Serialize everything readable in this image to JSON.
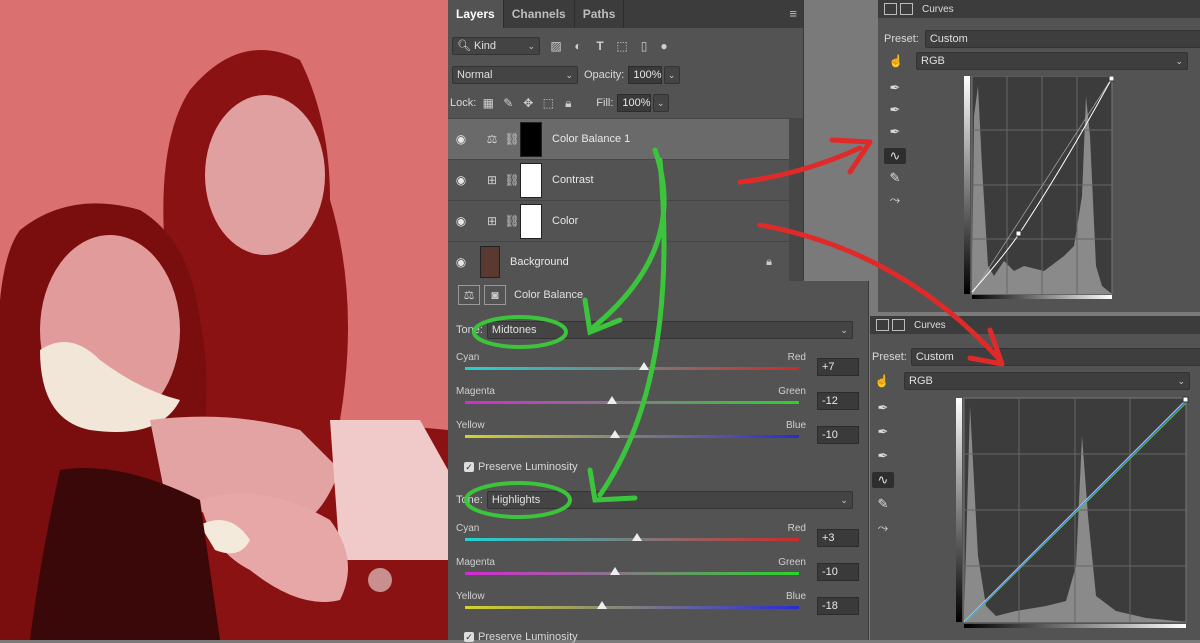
{
  "layers_panel": {
    "tabs": [
      "Layers",
      "Channels",
      "Paths"
    ],
    "filter_kind": "Kind",
    "blend_mode": "Normal",
    "opacity_label": "Opacity:",
    "opacity_value": "100%",
    "lock_label": "Lock:",
    "fill_label": "Fill:",
    "fill_value": "100%",
    "layers": [
      {
        "name": "Color Balance 1",
        "type": "color-balance"
      },
      {
        "name": "Contrast",
        "type": "curves"
      },
      {
        "name": "Color",
        "type": "curves"
      },
      {
        "name": "Background",
        "type": "image",
        "locked": true
      }
    ]
  },
  "color_balance": {
    "title": "Color Balance",
    "tone_label": "Tone:",
    "preserve_label": "Preserve Luminosity",
    "sections": [
      {
        "tone": "Midtones",
        "sliders": [
          {
            "left": "Cyan",
            "right": "Red",
            "value": "+7",
            "level": 7
          },
          {
            "left": "Magenta",
            "right": "Green",
            "value": "-12",
            "level": -12
          },
          {
            "left": "Yellow",
            "right": "Blue",
            "value": "-10",
            "level": -10
          }
        ]
      },
      {
        "tone": "Highlights",
        "sliders": [
          {
            "left": "Cyan",
            "right": "Red",
            "value": "+3",
            "level": 3
          },
          {
            "left": "Magenta",
            "right": "Green",
            "value": "-10",
            "level": -10
          },
          {
            "left": "Yellow",
            "right": "Blue",
            "value": "-18",
            "level": -18
          }
        ]
      }
    ]
  },
  "curves_top": {
    "title": "Curves",
    "preset_label": "Preset:",
    "preset_value": "Custom",
    "channel": "RGB"
  },
  "curves_bottom": {
    "title": "Curves",
    "preset_label": "Preset:",
    "preset_value": "Custom",
    "channel": "RGB"
  },
  "colors": {
    "annotation_red": "#e02a2a",
    "annotation_green": "#3cc43c",
    "photo_tint": "#d65a5a"
  }
}
